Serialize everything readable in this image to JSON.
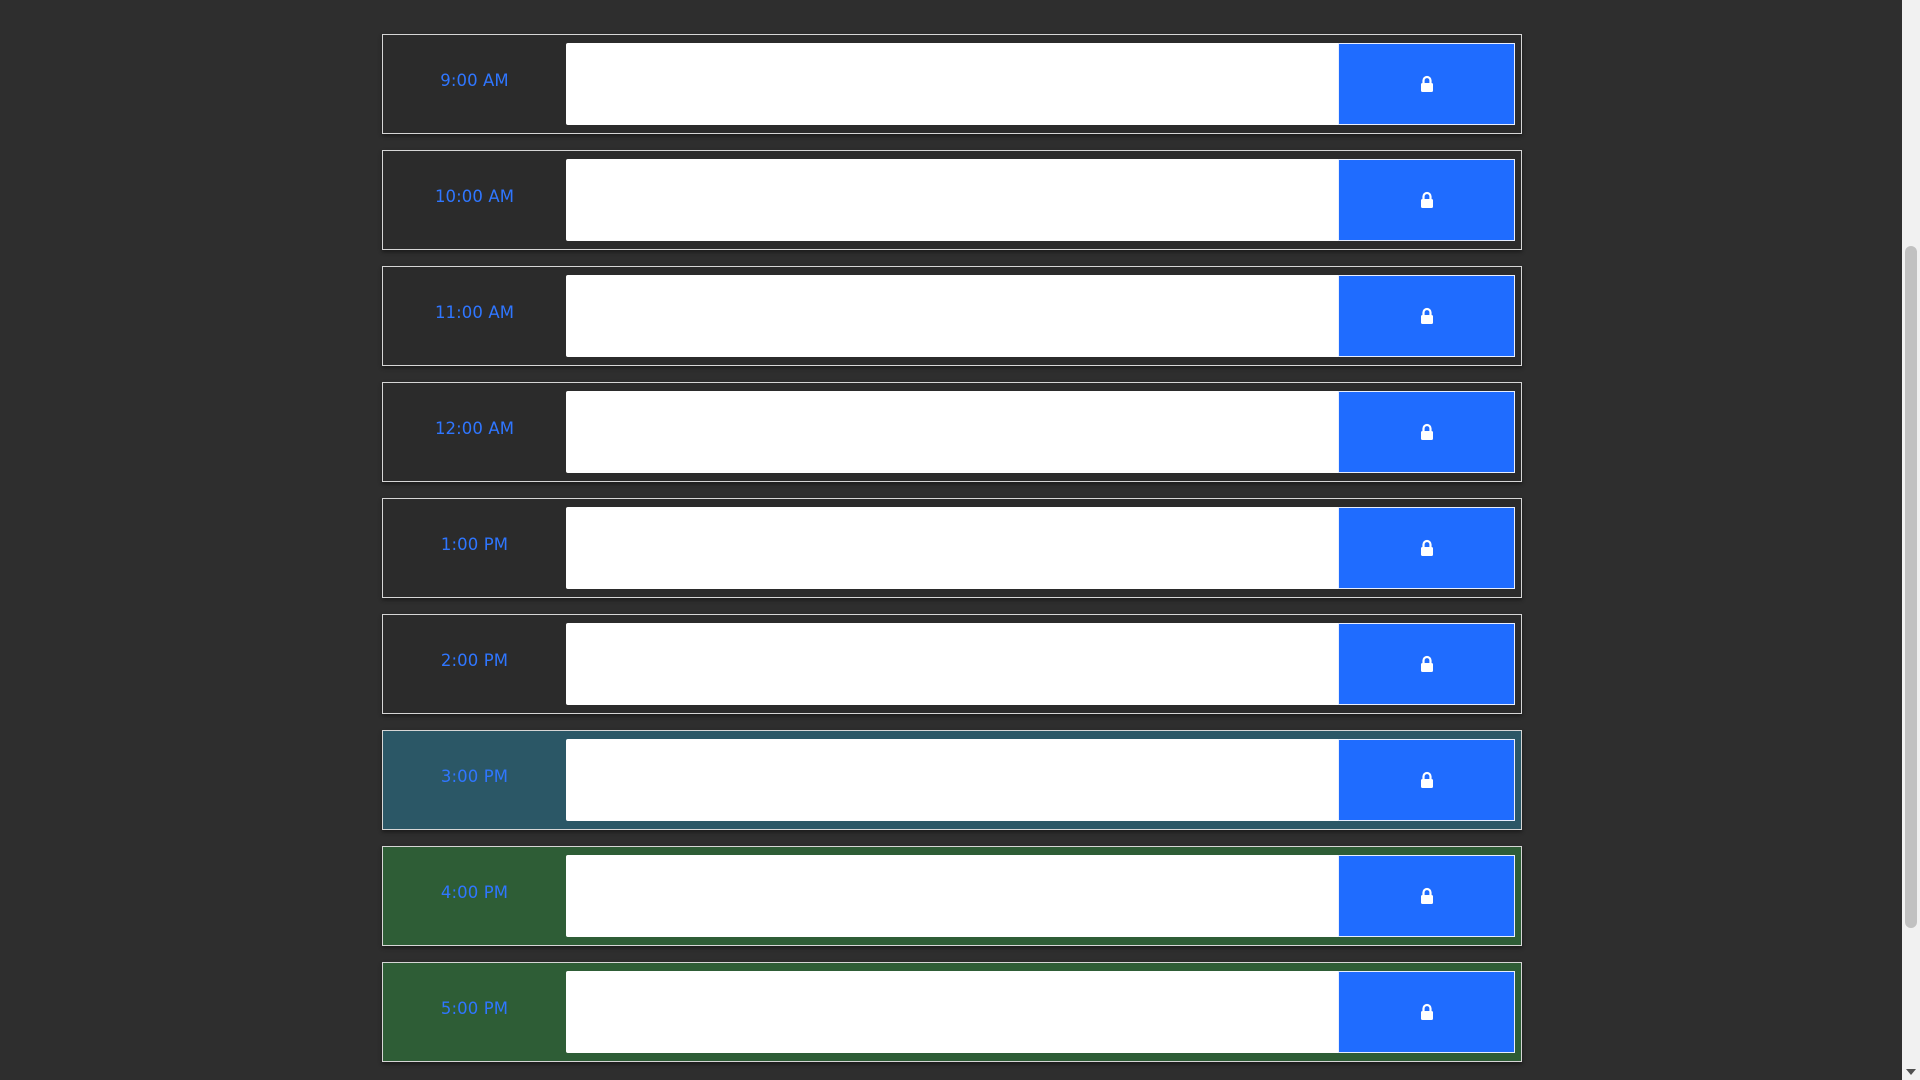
{
  "schedule": {
    "rows": [
      {
        "time": "9:00 AM",
        "status": "past",
        "event_text": ""
      },
      {
        "time": "10:00 AM",
        "status": "past",
        "event_text": ""
      },
      {
        "time": "11:00 AM",
        "status": "past",
        "event_text": ""
      },
      {
        "time": "12:00 AM",
        "status": "past",
        "event_text": ""
      },
      {
        "time": "1:00 PM",
        "status": "past",
        "event_text": ""
      },
      {
        "time": "2:00 PM",
        "status": "past",
        "event_text": ""
      },
      {
        "time": "3:00 PM",
        "status": "present",
        "event_text": ""
      },
      {
        "time": "4:00 PM",
        "status": "future",
        "event_text": ""
      },
      {
        "time": "5:00 PM",
        "status": "future",
        "event_text": ""
      }
    ],
    "save_icon": "lock-icon"
  },
  "colors": {
    "page_background": "#2e2e2e",
    "past_row": "#2b2b2b",
    "present_row": "#2b5766",
    "future_row": "#2e5d36",
    "time_text": "#2f76ff",
    "save_button": "#1f6cff",
    "input_background": "#ffffff"
  }
}
